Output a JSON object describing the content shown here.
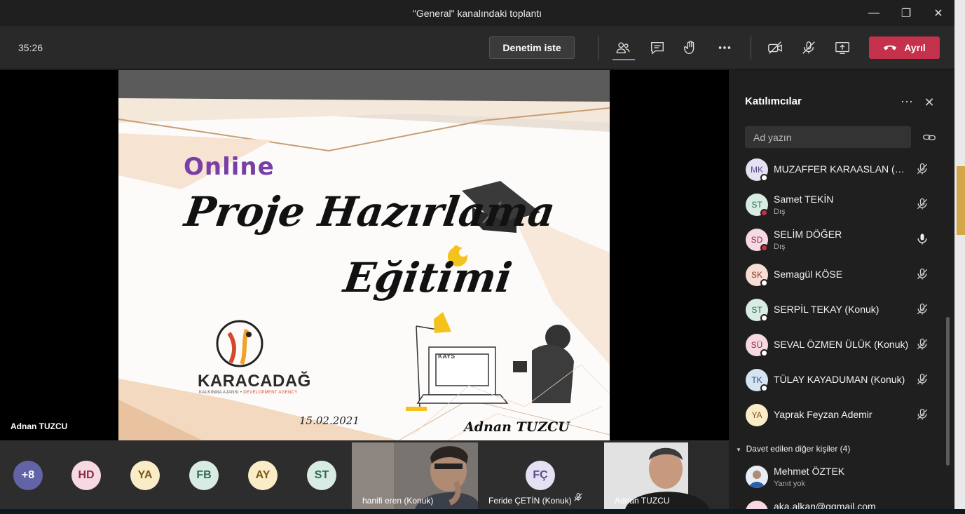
{
  "window": {
    "title": "\"General\" kanalındaki toplantı"
  },
  "toolbar": {
    "timer": "35:26",
    "control_label": "Denetim iste",
    "leave_label": "Ayrıl"
  },
  "slide": {
    "online": "Online",
    "title_line1": "Proje Hazırlama",
    "title_line2": "Eğitimi",
    "brand": "KARACADAĞ",
    "brand_sub_a": "KALKINMA AJANSI •",
    "brand_sub_b": "DEVELOPMENT AGENCY",
    "date": "15.02.2021",
    "author": "Adnan TUZCU",
    "screen_text": "KAYS"
  },
  "stage": {
    "presenter": "Adnan TUZCU"
  },
  "strip": {
    "avatars": [
      {
        "initials": "+8",
        "bg": "#6264a7",
        "fg": "#ffffff"
      },
      {
        "initials": "HD",
        "bg": "#f6d9e1",
        "fg": "#8a2b4a"
      },
      {
        "initials": "YA",
        "bg": "#fbecc8",
        "fg": "#7a5a12"
      },
      {
        "initials": "FB",
        "bg": "#d8ece3",
        "fg": "#2e6b52"
      },
      {
        "initials": "AY",
        "bg": "#fbecc8",
        "fg": "#7a5a12"
      },
      {
        "initials": "ST",
        "bg": "#d8ece3",
        "fg": "#2e6b52"
      }
    ],
    "tiles": [
      {
        "label": "hanifi eren (Konuk)"
      },
      {
        "label": "Feride ÇETİN (Konuk)",
        "initials": "FÇ"
      },
      {
        "label": "Adnan TUZCU"
      }
    ]
  },
  "pane": {
    "title": "Katılımcılar",
    "search_placeholder": "Ad yazın",
    "participants": [
      {
        "initials": "MK",
        "name": "MUZAFFER KARAASLAN (Konuk)",
        "sub": "",
        "bg": "#e6e1f2",
        "fg": "#5a4b8a",
        "status": "white",
        "mic": "muted"
      },
      {
        "initials": "ST",
        "name": "Samet TEKİN",
        "sub": "Dış",
        "bg": "#d8ece3",
        "fg": "#2e6b52",
        "status": "red",
        "mic": "muted"
      },
      {
        "initials": "SD",
        "name": "SELİM DÖĞER",
        "sub": "Dış",
        "bg": "#f6d9e1",
        "fg": "#8a2b4a",
        "status": "red",
        "mic": "on"
      },
      {
        "initials": "SK",
        "name": "Semagül KÖSE",
        "sub": "",
        "bg": "#f7ddd4",
        "fg": "#8a3b22",
        "status": "white",
        "mic": "muted"
      },
      {
        "initials": "ST",
        "name": "SERPİL TEKAY (Konuk)",
        "sub": "",
        "bg": "#d8ece3",
        "fg": "#2e6b52",
        "status": "white",
        "mic": "muted"
      },
      {
        "initials": "SÜ",
        "name": "SEVAL ÖZMEN ÜLÜK (Konuk)",
        "sub": "",
        "bg": "#f6d9e1",
        "fg": "#8a2b4a",
        "status": "white",
        "mic": "muted"
      },
      {
        "initials": "TK",
        "name": "TÜLAY KAYADUMAN (Konuk)",
        "sub": "",
        "bg": "#d6e3f3",
        "fg": "#2c4f80",
        "status": "white",
        "mic": "muted"
      },
      {
        "initials": "YA",
        "name": "Yaprak Feyzan Ademir",
        "sub": "",
        "bg": "#fbecc8",
        "fg": "#7a5a12",
        "status": "",
        "mic": "muted"
      }
    ],
    "section_label": "Davet edilen diğer kişiler (4)",
    "invited": [
      {
        "name": "Mehmet ÖZTEK",
        "sub": "Yanıt yok"
      },
      {
        "name": "aka.alkan@gqmail.com",
        "sub": ""
      }
    ]
  }
}
